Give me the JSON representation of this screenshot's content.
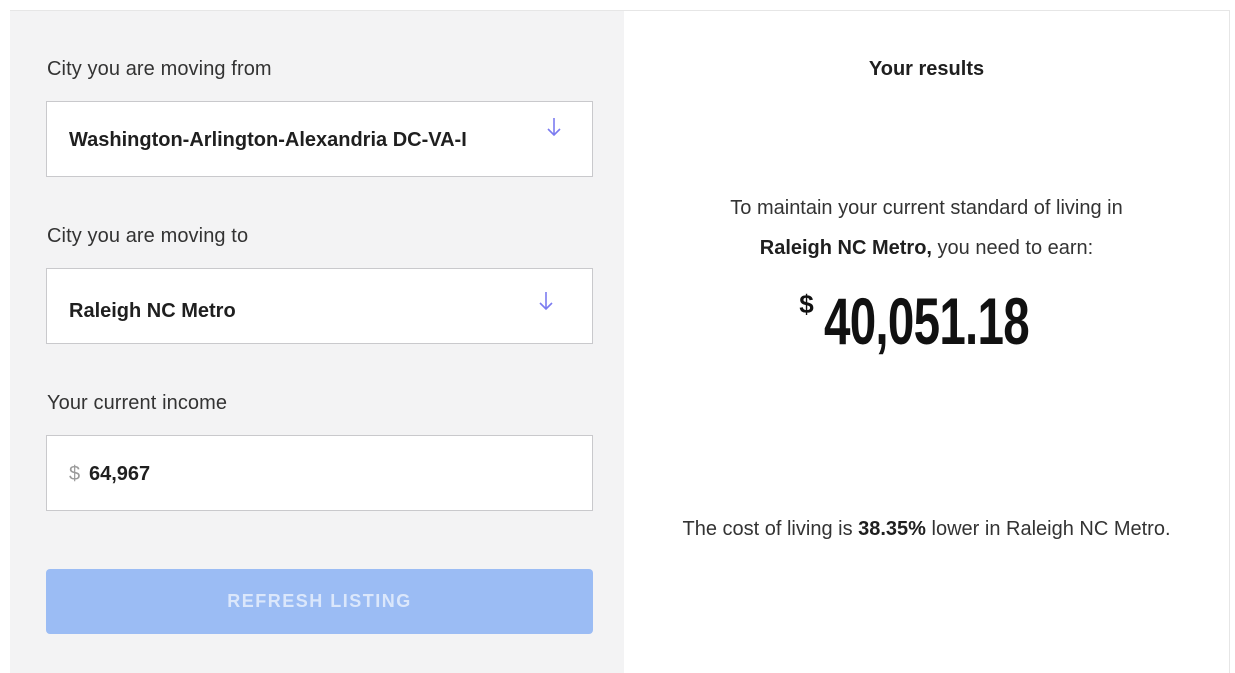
{
  "form": {
    "from_label": "City you are moving from",
    "from_value": "Washington-Arlington-Alexandria DC-VA-I",
    "to_label": "City you are moving to",
    "to_value": "Raleigh NC Metro",
    "income_label": "Your current income",
    "income_prefix": "$",
    "income_value": "64,967",
    "refresh_button": "REFRESH LISTING",
    "dropdown_icon": "arrow-down-icon"
  },
  "results": {
    "title": "Your results",
    "maintain_line1": "To maintain your current standard of living in",
    "maintain_city": "Raleigh NC Metro,",
    "maintain_suffix": " you need to earn:",
    "amount_symbol": "$",
    "amount_value": "40,051.18",
    "cost_prefix": "The cost of living is ",
    "cost_percent": "38.35%",
    "cost_suffix": " lower in Raleigh NC Metro."
  },
  "colors": {
    "accent": "#7b7bf0",
    "button_bg": "#9bbcf4",
    "left_panel_bg": "#f3f3f4"
  }
}
